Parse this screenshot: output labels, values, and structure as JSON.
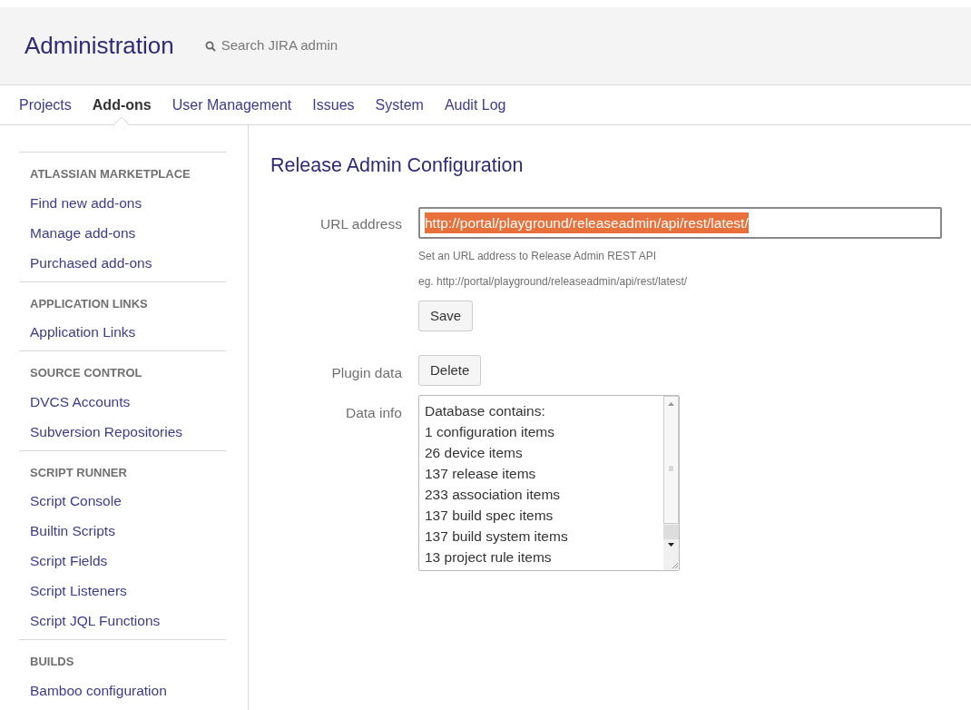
{
  "header": {
    "title": "Administration",
    "search": {
      "placeholder": "Search JIRA admin"
    }
  },
  "nav_tabs": [
    {
      "label": "Projects",
      "selected": false
    },
    {
      "label": "Add-ons",
      "selected": true
    },
    {
      "label": "User Management",
      "selected": false
    },
    {
      "label": "Issues",
      "selected": false
    },
    {
      "label": "System",
      "selected": false
    },
    {
      "label": "Audit Log",
      "selected": false
    }
  ],
  "sidebar": {
    "sections": [
      {
        "heading": "ATLASSIAN MARKETPLACE",
        "items": [
          "Find new add-ons",
          "Manage add-ons",
          "Purchased add-ons"
        ]
      },
      {
        "heading": "APPLICATION LINKS",
        "items": [
          "Application Links"
        ]
      },
      {
        "heading": "SOURCE CONTROL",
        "items": [
          "DVCS Accounts",
          "Subversion Repositories"
        ]
      },
      {
        "heading": "SCRIPT RUNNER",
        "items": [
          "Script Console",
          "Builtin Scripts",
          "Script Fields",
          "Script Listeners",
          "Script JQL Functions"
        ]
      },
      {
        "heading": "BUILDS",
        "items": [
          "Bamboo configuration"
        ]
      }
    ]
  },
  "page_title": "Release Admin Configuration",
  "url_field": {
    "label": "URL address",
    "value": "http://portal/playground/releaseadmin/api/rest/latest/",
    "value_selected": true,
    "help": [
      "Set an URL address to Release Admin REST API",
      "eg. http://portal/playground/releaseadmin/api/rest/latest/"
    ],
    "button": "Save"
  },
  "plugin_data": {
    "label": "Plugin data",
    "button": "Delete"
  },
  "data_info": {
    "label": "Data info",
    "lines": [
      "Database contains:",
      "1 configuration items",
      "26 device items",
      "137 release items",
      "233 association items",
      "137 build spec items",
      "137 build system items",
      "13 project rule items"
    ]
  }
}
